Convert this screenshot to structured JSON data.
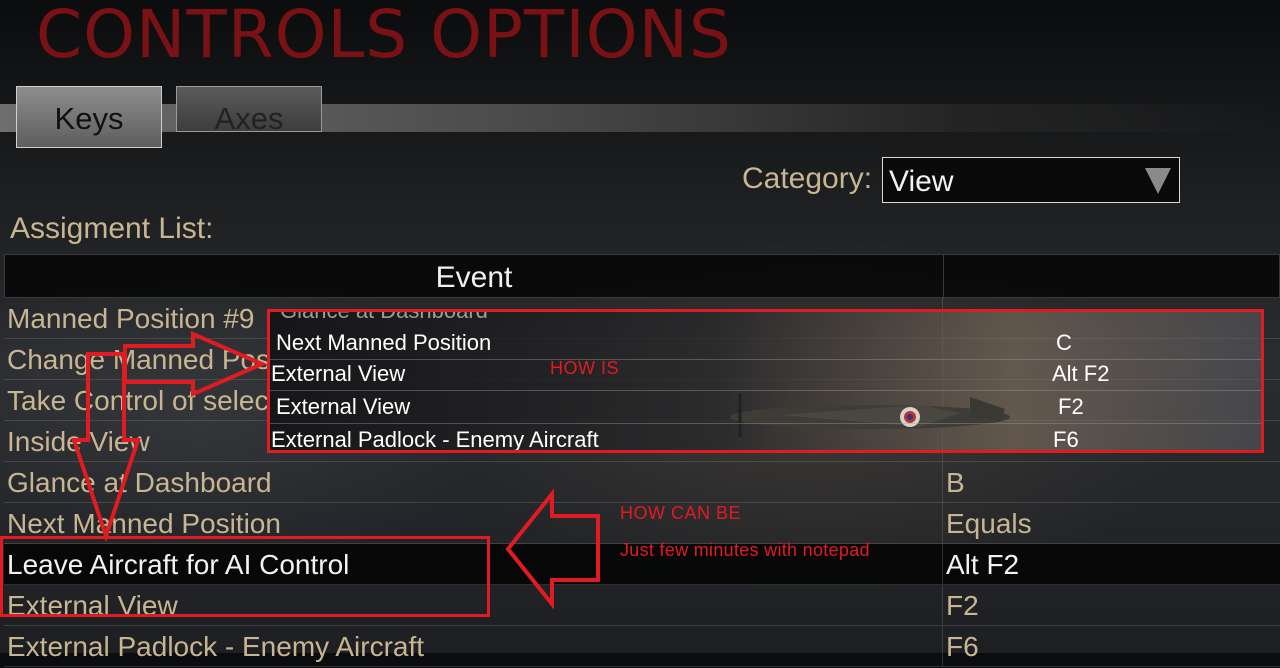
{
  "screen": {
    "title": "CONTROLS OPTIONS"
  },
  "tabs": [
    {
      "label": "Keys",
      "active": true
    },
    {
      "label": "Axes",
      "active": false
    }
  ],
  "category": {
    "label": "Category:",
    "value": "View"
  },
  "assignment_list": {
    "label": "Assigment List:",
    "columns": {
      "event": "Event",
      "key": ""
    },
    "rows": [
      {
        "event": "Manned Position #9",
        "key": ""
      },
      {
        "event": "Change Manned Pos",
        "key": ""
      },
      {
        "event": "Take Control of selec",
        "key": ""
      },
      {
        "event": "Inside View",
        "key": ""
      },
      {
        "event": "Glance at Dashboard",
        "key": "B"
      },
      {
        "event": "Next Manned Position",
        "key": "Equals"
      },
      {
        "event": "Leave Aircraft for AI Control",
        "key": "Alt F2",
        "selected": true
      },
      {
        "event": "External View",
        "key": "F2"
      },
      {
        "event": "External Padlock - Enemy Aircraft",
        "key": "F6"
      }
    ]
  },
  "overlay": {
    "ghost_text": "Glance at Dashboard",
    "label": "HOW IS",
    "rows": [
      {
        "event": "Next Manned Position",
        "key": "C"
      },
      {
        "event": "External View",
        "key": "Alt F2"
      },
      {
        "event": "External View",
        "key": "F2"
      },
      {
        "event": "External Padlock - Enemy Aircraft",
        "key": "F6"
      }
    ]
  },
  "annotations": {
    "how_can_be": "HOW CAN BE",
    "notepad_note": "Just few minutes with notepad"
  },
  "colors": {
    "title": "#7a1114",
    "annotation_red": "#e01b22",
    "text_tan": "#c8b592"
  }
}
